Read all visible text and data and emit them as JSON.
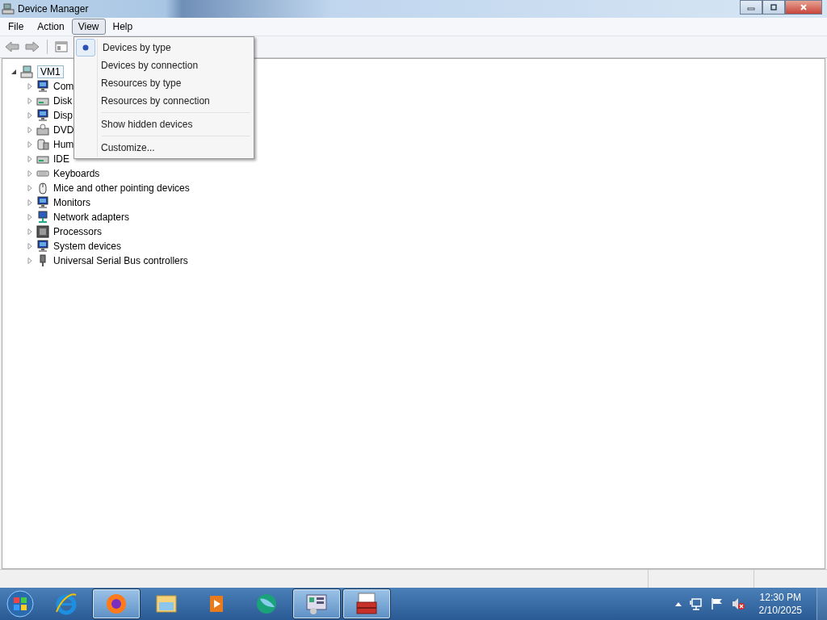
{
  "window": {
    "title": "Device Manager"
  },
  "menu_bar": [
    {
      "label": "File",
      "selected": false
    },
    {
      "label": "Action",
      "selected": false
    },
    {
      "label": "View",
      "selected": true
    },
    {
      "label": "Help",
      "selected": false
    }
  ],
  "view_menu": [
    {
      "label": "Devices by type",
      "checked": true,
      "separator_before": false
    },
    {
      "label": "Devices by connection",
      "checked": false,
      "separator_before": false
    },
    {
      "label": "Resources by type",
      "checked": false,
      "separator_before": false
    },
    {
      "label": "Resources by connection",
      "checked": false,
      "separator_before": false
    },
    {
      "label": "Show hidden devices",
      "checked": false,
      "separator_before": true
    },
    {
      "label": "Customize...",
      "checked": false,
      "separator_before": true
    }
  ],
  "tree": {
    "label": "VM1",
    "expanded": true,
    "selected": true,
    "children": [
      {
        "label": "Com",
        "kind": "computer",
        "expanded": false
      },
      {
        "label": "Disk",
        "kind": "disk",
        "expanded": false
      },
      {
        "label": "Disp",
        "kind": "display",
        "expanded": false
      },
      {
        "label": "DVD",
        "kind": "dvd",
        "expanded": false
      },
      {
        "label": "Hum",
        "kind": "hid",
        "expanded": false
      },
      {
        "label": "IDE",
        "kind": "ide",
        "expanded": false
      },
      {
        "label": "Keyboards",
        "kind": "keyboard",
        "expanded": false
      },
      {
        "label": "Mice and other pointing devices",
        "kind": "mouse",
        "expanded": false
      },
      {
        "label": "Monitors",
        "kind": "monitor",
        "expanded": false
      },
      {
        "label": "Network adapters",
        "kind": "network",
        "expanded": false
      },
      {
        "label": "Processors",
        "kind": "processor",
        "expanded": false
      },
      {
        "label": "System devices",
        "kind": "system",
        "expanded": false
      },
      {
        "label": "Universal Serial Bus controllers",
        "kind": "usb",
        "expanded": false
      }
    ]
  },
  "taskbar": {
    "apps": [
      {
        "kind": "ie",
        "active": false
      },
      {
        "kind": "firefox",
        "active": true
      },
      {
        "kind": "folder",
        "active": false
      },
      {
        "kind": "media",
        "active": false
      },
      {
        "kind": "globe",
        "active": false
      },
      {
        "kind": "panel",
        "active": true
      },
      {
        "kind": "toolbox",
        "active": true
      }
    ],
    "clock": {
      "time": "12:30 PM",
      "date": "2/10/2025"
    }
  }
}
